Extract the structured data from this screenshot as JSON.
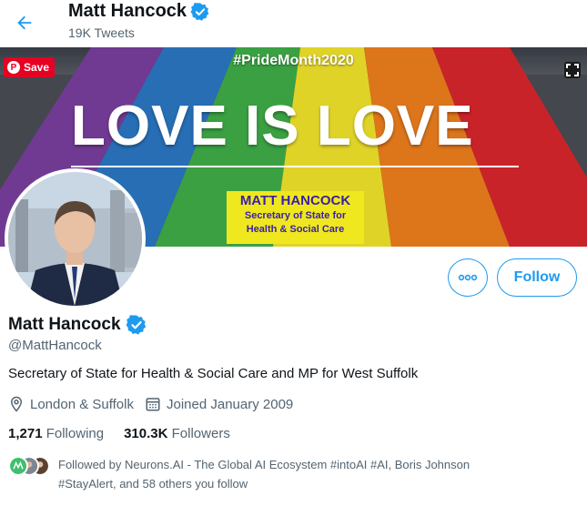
{
  "header": {
    "name": "Matt Hancock",
    "tweet_count": "19K Tweets"
  },
  "banner": {
    "hashtag": "#PrideMonth2020",
    "headline": "LOVE IS LOVE",
    "card_name": "MATT HANCOCK",
    "card_role_line1": "Secretary of State for",
    "card_role_line2": "Health & Social Care",
    "save_label": "Save",
    "stripe_colors": [
      "#d9262d",
      "#f07f1e",
      "#f3e52b",
      "#3fae48",
      "#2b78c5",
      "#7a3fa0"
    ]
  },
  "actions": {
    "follow_label": "Follow"
  },
  "profile": {
    "display_name": "Matt Hancock",
    "handle": "@MattHancock",
    "bio": "Secretary of State for Health & Social Care and MP for West Suffolk",
    "location": "London & Suffolk",
    "joined": "Joined January 2009",
    "following_count": "1,271",
    "following_label": "Following",
    "followers_count": "310.3K",
    "followers_label": "Followers",
    "followed_by_line1": "Followed by Neurons.AI - The Global AI Ecosystem #intoAI #AI, Boris Johnson",
    "followed_by_line2": "#StayAlert, and 58 others you follow"
  },
  "colors": {
    "accent": "#1d9bf0",
    "verified": "#1d9bf0",
    "secondary_text": "#536471",
    "pinterest_red": "#e60023"
  }
}
